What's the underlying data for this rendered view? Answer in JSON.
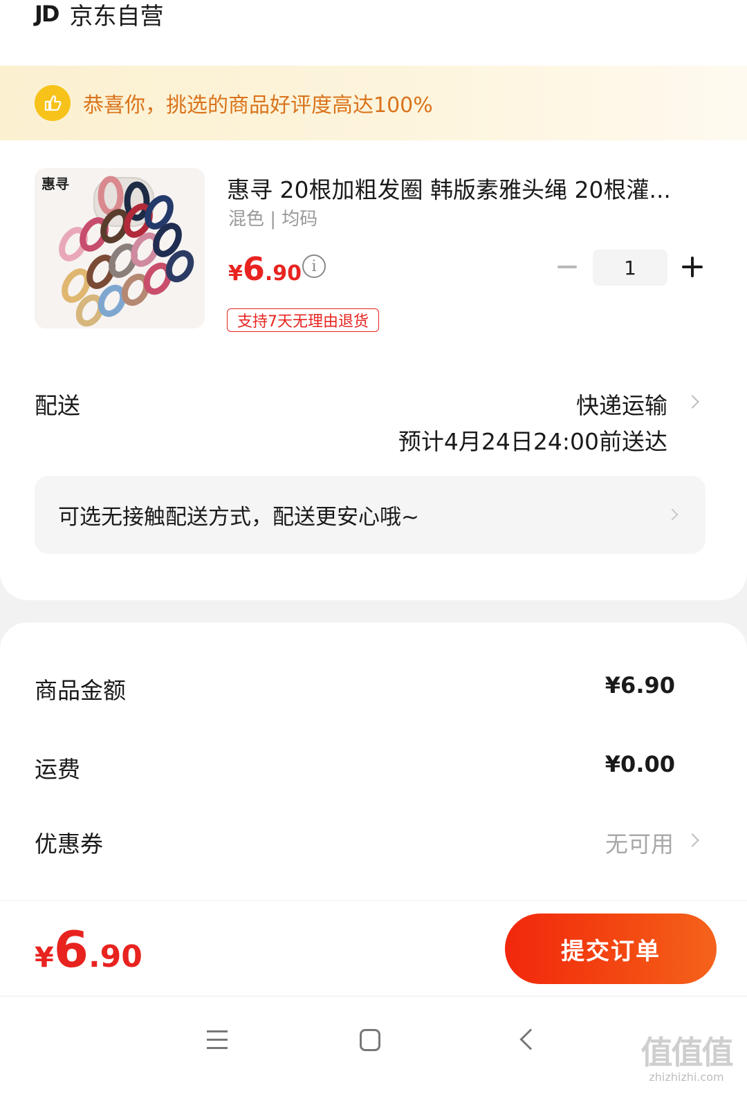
{
  "shop": {
    "logo": "JD",
    "name": "京东自营"
  },
  "banner": {
    "text": "恭喜你，挑选的商品好评度高达100%",
    "icon": "thumbs-up-icon"
  },
  "product": {
    "title": "惠寻 20根加粗发圈 韩版素雅头绳 20根灌...",
    "spec": "混色 | 均码",
    "image_brand": "惠寻",
    "price_currency": "¥",
    "price_int": "6",
    "price_dec": ".90",
    "info_glyph": "i",
    "quantity": "1",
    "return_tag": "支持7天无理由退货"
  },
  "delivery": {
    "label": "配送",
    "method": "快递运输",
    "eta": "预计4月24日24:00前送达",
    "contactless": "可选无接触配送方式，配送更安心哦~"
  },
  "summary": {
    "goods_label": "商品金额",
    "goods_value": "¥6.90",
    "shipping_label": "运费",
    "shipping_value": "¥0.00",
    "coupon_label": "优惠券",
    "coupon_value": "无可用"
  },
  "footer": {
    "total_currency": "¥",
    "total_int": "6",
    "total_dec": ".90",
    "submit_label": "提交订单"
  },
  "watermark": {
    "big": "值值值",
    "small": "zhizhizhi.com"
  },
  "colors": {
    "accent": "#e8231f",
    "banner_text": "#d9731b",
    "thumb_icon": "#f7c21a",
    "submit_start": "#f2270c",
    "submit_end": "#f5631b"
  }
}
